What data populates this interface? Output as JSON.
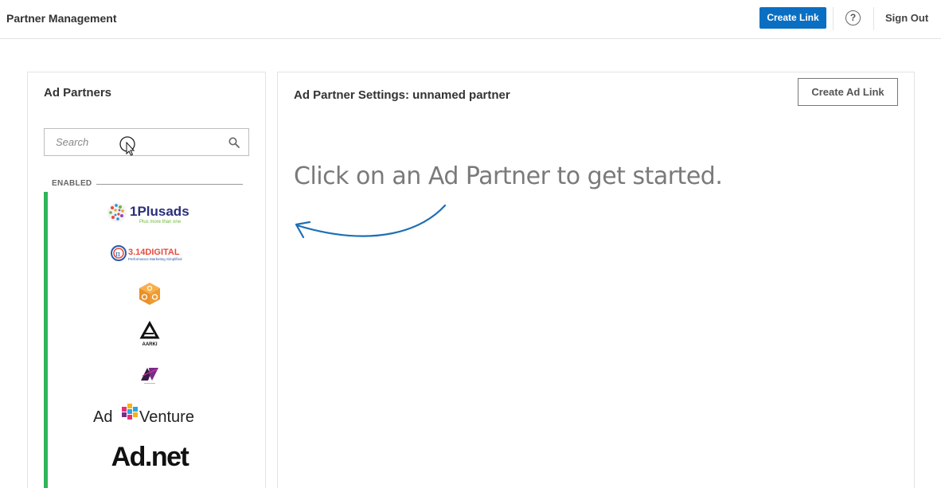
{
  "header": {
    "title": "Partner Management",
    "create_link_label": "Create Link",
    "help_glyph": "?",
    "sign_out_label": "Sign Out",
    "accent_color": "#0a6fc2"
  },
  "left_panel": {
    "title": "Ad Partners",
    "search_placeholder": "Search",
    "section_label": "ENABLED",
    "status_color": "#2fb55a",
    "partners": [
      {
        "logo_text": "1Plusads",
        "logo_subtext": "Plus more than one"
      },
      {
        "logo_text": "3.14DIGITAL",
        "logo_subtext": "Performance Marketing Simplified"
      },
      {
        "logo_text": "",
        "logo_subtext": ""
      },
      {
        "logo_text": "AARKI",
        "logo_subtext": ""
      },
      {
        "logo_text": "",
        "logo_subtext": ""
      },
      {
        "logo_text": "Ad",
        "logo_text_2": "Venture"
      },
      {
        "logo_text": "Ad.net"
      }
    ]
  },
  "right_panel": {
    "title": "Ad Partner Settings: unnamed partner",
    "create_ad_link_label": "Create Ad Link",
    "empty_message": "Click on an Ad Partner to get started."
  }
}
